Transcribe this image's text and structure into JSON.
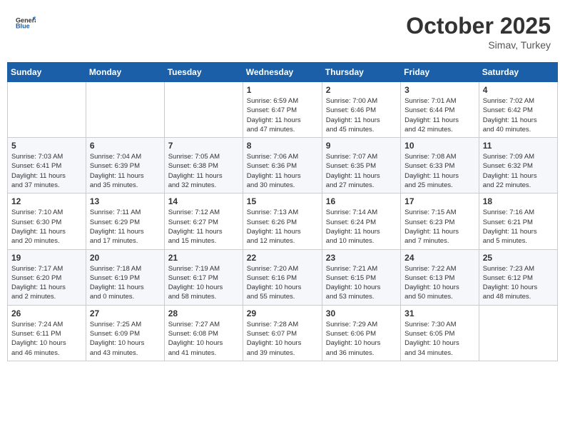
{
  "header": {
    "logo_line1": "General",
    "logo_line2": "Blue",
    "month": "October 2025",
    "location": "Simav, Turkey"
  },
  "weekdays": [
    "Sunday",
    "Monday",
    "Tuesday",
    "Wednesday",
    "Thursday",
    "Friday",
    "Saturday"
  ],
  "weeks": [
    [
      {
        "day": "",
        "info": ""
      },
      {
        "day": "",
        "info": ""
      },
      {
        "day": "",
        "info": ""
      },
      {
        "day": "1",
        "info": "Sunrise: 6:59 AM\nSunset: 6:47 PM\nDaylight: 11 hours\nand 47 minutes."
      },
      {
        "day": "2",
        "info": "Sunrise: 7:00 AM\nSunset: 6:46 PM\nDaylight: 11 hours\nand 45 minutes."
      },
      {
        "day": "3",
        "info": "Sunrise: 7:01 AM\nSunset: 6:44 PM\nDaylight: 11 hours\nand 42 minutes."
      },
      {
        "day": "4",
        "info": "Sunrise: 7:02 AM\nSunset: 6:42 PM\nDaylight: 11 hours\nand 40 minutes."
      }
    ],
    [
      {
        "day": "5",
        "info": "Sunrise: 7:03 AM\nSunset: 6:41 PM\nDaylight: 11 hours\nand 37 minutes."
      },
      {
        "day": "6",
        "info": "Sunrise: 7:04 AM\nSunset: 6:39 PM\nDaylight: 11 hours\nand 35 minutes."
      },
      {
        "day": "7",
        "info": "Sunrise: 7:05 AM\nSunset: 6:38 PM\nDaylight: 11 hours\nand 32 minutes."
      },
      {
        "day": "8",
        "info": "Sunrise: 7:06 AM\nSunset: 6:36 PM\nDaylight: 11 hours\nand 30 minutes."
      },
      {
        "day": "9",
        "info": "Sunrise: 7:07 AM\nSunset: 6:35 PM\nDaylight: 11 hours\nand 27 minutes."
      },
      {
        "day": "10",
        "info": "Sunrise: 7:08 AM\nSunset: 6:33 PM\nDaylight: 11 hours\nand 25 minutes."
      },
      {
        "day": "11",
        "info": "Sunrise: 7:09 AM\nSunset: 6:32 PM\nDaylight: 11 hours\nand 22 minutes."
      }
    ],
    [
      {
        "day": "12",
        "info": "Sunrise: 7:10 AM\nSunset: 6:30 PM\nDaylight: 11 hours\nand 20 minutes."
      },
      {
        "day": "13",
        "info": "Sunrise: 7:11 AM\nSunset: 6:29 PM\nDaylight: 11 hours\nand 17 minutes."
      },
      {
        "day": "14",
        "info": "Sunrise: 7:12 AM\nSunset: 6:27 PM\nDaylight: 11 hours\nand 15 minutes."
      },
      {
        "day": "15",
        "info": "Sunrise: 7:13 AM\nSunset: 6:26 PM\nDaylight: 11 hours\nand 12 minutes."
      },
      {
        "day": "16",
        "info": "Sunrise: 7:14 AM\nSunset: 6:24 PM\nDaylight: 11 hours\nand 10 minutes."
      },
      {
        "day": "17",
        "info": "Sunrise: 7:15 AM\nSunset: 6:23 PM\nDaylight: 11 hours\nand 7 minutes."
      },
      {
        "day": "18",
        "info": "Sunrise: 7:16 AM\nSunset: 6:21 PM\nDaylight: 11 hours\nand 5 minutes."
      }
    ],
    [
      {
        "day": "19",
        "info": "Sunrise: 7:17 AM\nSunset: 6:20 PM\nDaylight: 11 hours\nand 2 minutes."
      },
      {
        "day": "20",
        "info": "Sunrise: 7:18 AM\nSunset: 6:19 PM\nDaylight: 11 hours\nand 0 minutes."
      },
      {
        "day": "21",
        "info": "Sunrise: 7:19 AM\nSunset: 6:17 PM\nDaylight: 10 hours\nand 58 minutes."
      },
      {
        "day": "22",
        "info": "Sunrise: 7:20 AM\nSunset: 6:16 PM\nDaylight: 10 hours\nand 55 minutes."
      },
      {
        "day": "23",
        "info": "Sunrise: 7:21 AM\nSunset: 6:15 PM\nDaylight: 10 hours\nand 53 minutes."
      },
      {
        "day": "24",
        "info": "Sunrise: 7:22 AM\nSunset: 6:13 PM\nDaylight: 10 hours\nand 50 minutes."
      },
      {
        "day": "25",
        "info": "Sunrise: 7:23 AM\nSunset: 6:12 PM\nDaylight: 10 hours\nand 48 minutes."
      }
    ],
    [
      {
        "day": "26",
        "info": "Sunrise: 7:24 AM\nSunset: 6:11 PM\nDaylight: 10 hours\nand 46 minutes."
      },
      {
        "day": "27",
        "info": "Sunrise: 7:25 AM\nSunset: 6:09 PM\nDaylight: 10 hours\nand 43 minutes."
      },
      {
        "day": "28",
        "info": "Sunrise: 7:27 AM\nSunset: 6:08 PM\nDaylight: 10 hours\nand 41 minutes."
      },
      {
        "day": "29",
        "info": "Sunrise: 7:28 AM\nSunset: 6:07 PM\nDaylight: 10 hours\nand 39 minutes."
      },
      {
        "day": "30",
        "info": "Sunrise: 7:29 AM\nSunset: 6:06 PM\nDaylight: 10 hours\nand 36 minutes."
      },
      {
        "day": "31",
        "info": "Sunrise: 7:30 AM\nSunset: 6:05 PM\nDaylight: 10 hours\nand 34 minutes."
      },
      {
        "day": "",
        "info": ""
      }
    ]
  ]
}
